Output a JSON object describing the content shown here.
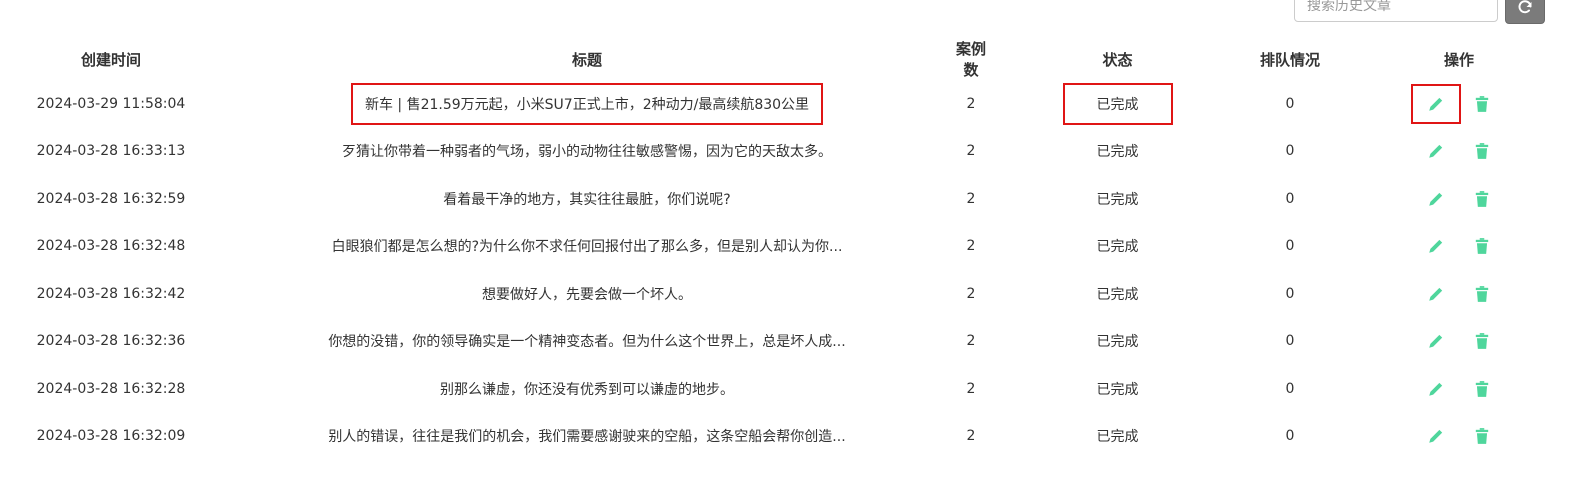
{
  "search": {
    "placeholder": "搜索历史文章"
  },
  "icons": {
    "refresh": "refresh-icon",
    "edit": "pencil-icon",
    "delete": "trash-icon"
  },
  "colors": {
    "action": "#4fd69c",
    "highlight": "#e01515",
    "refresh_bg": "#7b7b7b"
  },
  "table": {
    "headers": {
      "created": "创建时间",
      "title": "标题",
      "cases": "案例数",
      "status": "状态",
      "queue": "排队情况",
      "actions": "操作"
    },
    "rows": [
      {
        "created": "2024-03-29 11:58:04",
        "title": "新车 | 售21.59万元起，小米SU7正式上市，2种动力/最高续航830公里",
        "cases": "2",
        "status": "已完成",
        "queue": "0"
      },
      {
        "created": "2024-03-28 16:33:13",
        "title": "歹猜让你带着一种弱者的气场，弱小的动物往往敏感警惕，因为它的天敌太多。",
        "cases": "2",
        "status": "已完成",
        "queue": "0"
      },
      {
        "created": "2024-03-28 16:32:59",
        "title": "看着最干净的地方，其实往往最脏，你们说呢?",
        "cases": "2",
        "status": "已完成",
        "queue": "0"
      },
      {
        "created": "2024-03-28 16:32:48",
        "title": "白眼狼们都是怎么想的?为什么你不求任何回报付出了那么多，但是别人却认为你...",
        "cases": "2",
        "status": "已完成",
        "queue": "0"
      },
      {
        "created": "2024-03-28 16:32:42",
        "title": "想要做好人，先要会做一个坏人。",
        "cases": "2",
        "status": "已完成",
        "queue": "0"
      },
      {
        "created": "2024-03-28 16:32:36",
        "title": "你想的没错，你的领导确实是一个精神变态者。但为什么这个世界上，总是坏人成...",
        "cases": "2",
        "status": "已完成",
        "queue": "0"
      },
      {
        "created": "2024-03-28 16:32:28",
        "title": "别那么谦虚，你还没有优秀到可以谦虚的地步。",
        "cases": "2",
        "status": "已完成",
        "queue": "0"
      },
      {
        "created": "2024-03-28 16:32:09",
        "title": "别人的错误，往往是我们的机会，我们需要感谢驶来的空船，这条空船会帮你创造...",
        "cases": "2",
        "status": "已完成",
        "queue": "0"
      }
    ]
  }
}
